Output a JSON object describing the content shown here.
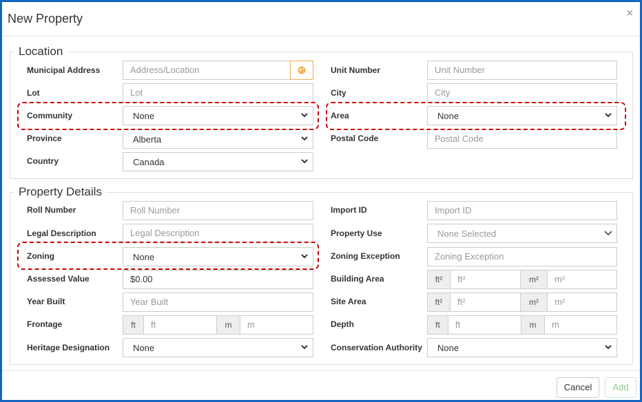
{
  "dialog": {
    "title": "New Property",
    "close_glyph": "×"
  },
  "location": {
    "legend": "Location",
    "municipal_address": {
      "label": "Municipal Address",
      "placeholder": "Address/Location"
    },
    "unit_number": {
      "label": "Unit Number",
      "placeholder": "Unit Number"
    },
    "lot": {
      "label": "Lot",
      "placeholder": "Lot"
    },
    "city": {
      "label": "City",
      "placeholder": "City"
    },
    "community": {
      "label": "Community",
      "value": "None"
    },
    "area": {
      "label": "Area",
      "value": "None"
    },
    "province": {
      "label": "Province",
      "value": "Alberta"
    },
    "postal_code": {
      "label": "Postal Code",
      "placeholder": "Postal Code"
    },
    "country": {
      "label": "Country",
      "value": "Canada"
    }
  },
  "details": {
    "legend": "Property Details",
    "roll_number": {
      "label": "Roll Number",
      "placeholder": "Roll Number"
    },
    "import_id": {
      "label": "Import ID",
      "placeholder": "Import ID"
    },
    "legal_description": {
      "label": "Legal Description",
      "placeholder": "Legal Description"
    },
    "property_use": {
      "label": "Property Use",
      "value": "None Selected"
    },
    "zoning": {
      "label": "Zoning",
      "value": "None"
    },
    "zoning_exception": {
      "label": "Zoning Exception",
      "placeholder": "Zoning Exception"
    },
    "assessed_value": {
      "label": "Assessed Value",
      "value": "$0.00"
    },
    "building_area": {
      "label": "Building Area",
      "unit_a": "ft²",
      "placeholder_a": "ft²",
      "unit_b": "m²",
      "placeholder_b": "m²"
    },
    "year_built": {
      "label": "Year Built",
      "placeholder": "Year Built"
    },
    "site_area": {
      "label": "Site Area",
      "unit_a": "ft²",
      "placeholder_a": "ft²",
      "unit_b": "m²",
      "placeholder_b": "m²"
    },
    "frontage": {
      "label": "Frontage",
      "unit_a": "ft",
      "placeholder_a": "ft",
      "unit_b": "m",
      "placeholder_b": "m"
    },
    "depth": {
      "label": "Depth",
      "unit_a": "ft",
      "placeholder_a": "ft",
      "unit_b": "m",
      "placeholder_b": "m"
    },
    "heritage_designation": {
      "label": "Heritage Designation",
      "value": "None"
    },
    "conservation_authority": {
      "label": "Conservation Authority",
      "value": "None"
    }
  },
  "footer": {
    "cancel_label": "Cancel",
    "add_label": "Add"
  },
  "colors": {
    "frame_border": "#1565c0",
    "highlight_dash": "#cc0000",
    "geo_button": "#f0ad4e",
    "add_text": "#8cc88c"
  },
  "icons": {
    "geo": "globe-icon",
    "chevron": "chevron-down-icon",
    "close": "close-icon"
  }
}
